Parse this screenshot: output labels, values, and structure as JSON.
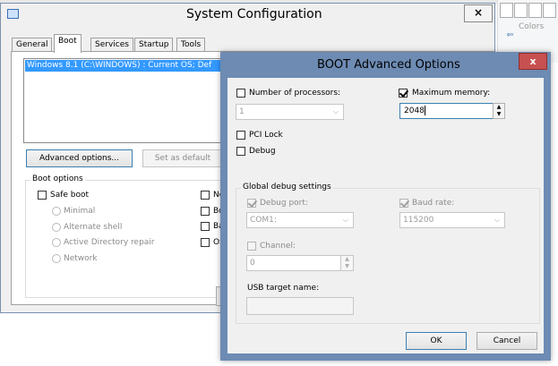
{
  "background_window": {
    "title": "System Configuration",
    "close_glyph": "×",
    "tabs": [
      "General",
      "Boot",
      "Services",
      "Startup",
      "Tools"
    ],
    "os_entry": "Windows 8.1 (C:\\WINDOWS) : Current OS; Def",
    "advanced_button": "Advanced options...",
    "default_button": "Set as default",
    "boot_options_label": "Boot options",
    "safe_boot": "Safe boot",
    "radios": [
      "Minimal",
      "Alternate shell",
      "Active Directory repair",
      "Network"
    ],
    "right_col_partial": [
      "No",
      "Bo",
      "Ba",
      "OS"
    ]
  },
  "paint_fragment": {
    "colors_label": "Colors",
    "tag": "ᵠᵒ"
  },
  "dialog": {
    "title": "BOOT Advanced Options",
    "close_glyph": "x",
    "number_of_processors": {
      "label": "Number of processors:",
      "checked": false,
      "value": "1"
    },
    "maximum_memory": {
      "label": "Maximum memory:",
      "checked": true,
      "value": "2048"
    },
    "pci_lock": {
      "label": "PCI Lock",
      "checked": false
    },
    "debug": {
      "label": "Debug",
      "checked": false
    },
    "global_debug": {
      "legend": "Global debug settings",
      "debug_port": {
        "label": "Debug port:",
        "checked": true,
        "value": "COM1:"
      },
      "baud_rate": {
        "label": "Baud rate:",
        "checked": true,
        "value": "115200"
      },
      "channel": {
        "label": "Channel:",
        "checked": false,
        "value": "0"
      },
      "usb_target": {
        "label": "USB target name:",
        "value": ""
      }
    },
    "ok": "OK",
    "cancel": "Cancel"
  },
  "colors": {
    "close_red": "#c75050",
    "selection": "#3399ff",
    "window_bg": "#f0f0f0",
    "frame_border": "#6b85a8"
  },
  "icons": [
    "app-icon",
    "close-icon",
    "chevron-down-icon",
    "spin-up-icon",
    "spin-down-icon"
  ]
}
